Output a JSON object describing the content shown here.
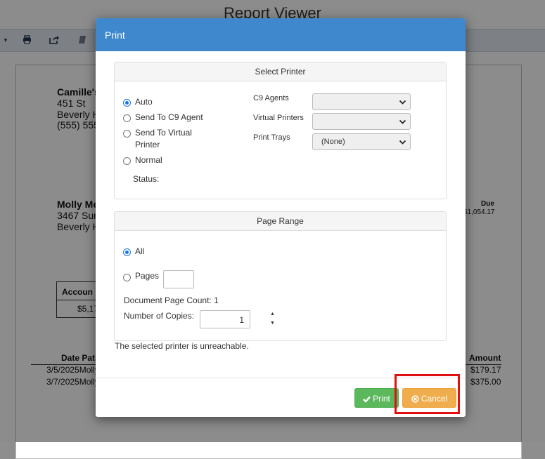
{
  "background": {
    "title": "Report Viewer",
    "company": {
      "name": "Camille's",
      "street": "451 St",
      "city": "Beverly H",
      "phone": "(555) 555"
    },
    "customer": {
      "name": "Molly Me",
      "street": "3467 Sun",
      "city": "Beverly H"
    },
    "due_label": "Due",
    "due_amount": "$1,054.17",
    "account_header": "Accoun",
    "account_value": "$5,17",
    "table_header_left": "Date Pati",
    "table_header_right": "Amount",
    "rows": [
      {
        "left": "3/5/2025Molly",
        "amount": "$179.17"
      },
      {
        "left": "3/7/2025Molly",
        "amount": "$375.00"
      }
    ]
  },
  "dialog": {
    "title": "Print",
    "select_printer": {
      "heading": "Select Printer",
      "options": [
        "Auto",
        "Send To C9 Agent",
        "Send To Virtual",
        "Printer",
        "Normal"
      ],
      "selected": "Auto",
      "status_label": "Status:",
      "c9_agents_label": "C9 Agents",
      "c9_agents_value": "",
      "virtual_printers_label": "Virtual Printers",
      "virtual_printers_value": "",
      "print_trays_label": "Print Trays",
      "print_trays_value": "(None)"
    },
    "page_range": {
      "heading": "Page Range",
      "all_label": "All",
      "pages_label": "Pages",
      "pages_value": "",
      "selected": "All",
      "document_page_count": "Document Page Count: 1",
      "copies_label": "Number of Copies:",
      "copies_value": "1"
    },
    "message": "The selected printer is unreachable.",
    "print_button": "Print",
    "cancel_button": "Cancel",
    "colors": {
      "header": "#3f88cd",
      "print": "#5cb85c",
      "cancel": "#f0ad4e",
      "highlight": "#e01010"
    }
  }
}
